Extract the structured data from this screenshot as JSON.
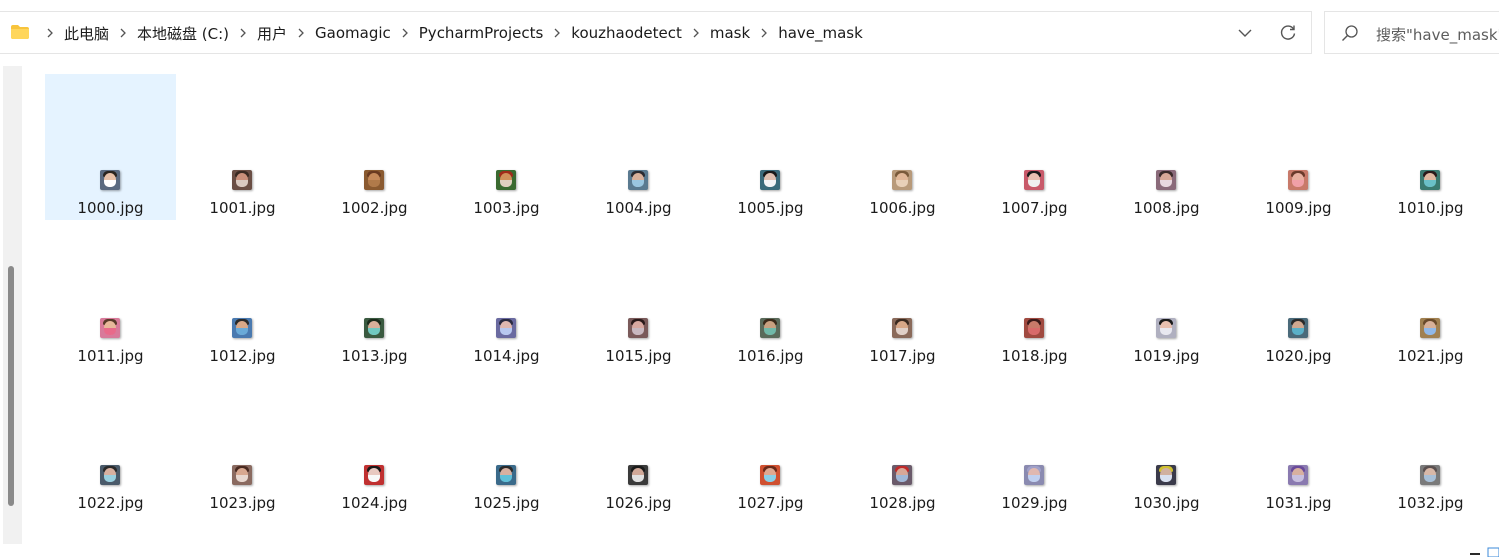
{
  "address_bar": {
    "crumbs": [
      "此电脑",
      "本地磁盘 (C:)",
      "用户",
      "Gaomagic",
      "PycharmProjects",
      "kouzhaodetect",
      "mask",
      "have_mask"
    ]
  },
  "search": {
    "placeholder": "搜索\"have_mask\""
  },
  "colors": {
    "selected_bg": "#e5f3ff",
    "folder_yellow": "#f8c43c",
    "text": "#1b1b1b"
  },
  "files": [
    {
      "name": "1000.jpg",
      "selected": true,
      "face": "#e8c1a8",
      "mask": "#ffffff",
      "bg": "#5a6a80",
      "hair": "#2a2520"
    },
    {
      "name": "1001.jpg",
      "face": "#c98f7a",
      "mask": "#d9c9c0",
      "bg": "#6a4e44",
      "hair": "#3a2a22"
    },
    {
      "name": "1002.jpg",
      "face": "#c68a5a",
      "mask": "#b07a4a",
      "bg": "#8a5a30",
      "hair": "#6a3a20"
    },
    {
      "name": "1003.jpg",
      "face": "#d0905a",
      "mask": "#e0d0c0",
      "bg": "#3a6a30",
      "hair": "#a02a1a"
    },
    {
      "name": "1004.jpg",
      "face": "#d8b09a",
      "mask": "#9ac6e0",
      "bg": "#5a7a90",
      "hair": "#2a2a30"
    },
    {
      "name": "1005.jpg",
      "face": "#e0c0b0",
      "mask": "#f4f4f6",
      "bg": "#3a6a7a",
      "hair": "#1a1a1a"
    },
    {
      "name": "1006.jpg",
      "face": "#e2b898",
      "mask": "#e8d0b8",
      "bg": "#b89a7a",
      "hair": "#7a5a3a"
    },
    {
      "name": "1007.jpg",
      "face": "#e8c0b0",
      "mask": "#f0f0f0",
      "bg": "#c85a6a",
      "hair": "#1a1a1a"
    },
    {
      "name": "1008.jpg",
      "face": "#d8a898",
      "mask": "#e8d8e0",
      "bg": "#8a6a7a",
      "hair": "#3a2a2a"
    },
    {
      "name": "1009.jpg",
      "face": "#e8b0a0",
      "mask": "#f0a0a8",
      "bg": "#c87a6a",
      "hair": "#6a3a2a"
    },
    {
      "name": "1010.jpg",
      "face": "#e0b8a0",
      "mask": "#6ac0c8",
      "bg": "#3a7a70",
      "hair": "#2a1a1a"
    },
    {
      "name": "1011.jpg",
      "face": "#e8b89a",
      "mask": "#e86a8a",
      "bg": "#d87a9a",
      "hair": "#5a3a2a"
    },
    {
      "name": "1012.jpg",
      "face": "#d8a888",
      "mask": "#6aaad8",
      "bg": "#4a7ab0",
      "hair": "#2a2a2a"
    },
    {
      "name": "1013.jpg",
      "face": "#d8b09a",
      "mask": "#70c8c0",
      "bg": "#3a5a40",
      "hair": "#1a2a1a"
    },
    {
      "name": "1014.jpg",
      "face": "#e0b8b0",
      "mask": "#b8c8f0",
      "bg": "#6a6aa0",
      "hair": "#2a2a40"
    },
    {
      "name": "1015.jpg",
      "face": "#d8a8a0",
      "mask": "#c8b8c0",
      "bg": "#7a5a5a",
      "hair": "#2a1a1a"
    },
    {
      "name": "1016.jpg",
      "face": "#c8a080",
      "mask": "#70b8a8",
      "bg": "#5a6a5a",
      "hair": "#3a2a1a"
    },
    {
      "name": "1017.jpg",
      "face": "#d8a888",
      "mask": "#e0d0c8",
      "bg": "#8a6a5a",
      "hair": "#3a2a20"
    },
    {
      "name": "1018.jpg",
      "face": "#c87a6a",
      "mask": "#d86a6a",
      "bg": "#a04a40",
      "hair": "#3a1a1a"
    },
    {
      "name": "1019.jpg",
      "face": "#e8c0b0",
      "mask": "#e8e8f0",
      "bg": "#b0b0c0",
      "hair": "#1a1a1a"
    },
    {
      "name": "1020.jpg",
      "face": "#d0a890",
      "mask": "#5ab0c8",
      "bg": "#4a6a7a",
      "hair": "#2a2a2a"
    },
    {
      "name": "1021.jpg",
      "face": "#d8b098",
      "mask": "#90b8e8",
      "bg": "#a08050",
      "hair": "#6a4a2a"
    },
    {
      "name": "1022.jpg",
      "face": "#d8b0a0",
      "mask": "#9ad0e0",
      "bg": "#4a5a6a",
      "hair": "#2a2a2a"
    },
    {
      "name": "1023.jpg",
      "face": "#d8a890",
      "mask": "#e8d8d0",
      "bg": "#8a6a60",
      "hair": "#4a2a20"
    },
    {
      "name": "1024.jpg",
      "face": "#e8c8c0",
      "mask": "#f8f8f8",
      "bg": "#c03030",
      "hair": "#1a1a1a"
    },
    {
      "name": "1025.jpg",
      "face": "#d8b0a0",
      "mask": "#60c0d8",
      "bg": "#3a6a8a",
      "hair": "#2a2a2a"
    },
    {
      "name": "1026.jpg",
      "face": "#d0a898",
      "mask": "#e0e0e0",
      "bg": "#3a3a3a",
      "hair": "#1a1a1a"
    },
    {
      "name": "1027.jpg",
      "face": "#e0a890",
      "mask": "#8ad0e8",
      "bg": "#d05030",
      "hair": "#6a2a1a"
    },
    {
      "name": "1028.jpg",
      "face": "#d8a898",
      "mask": "#a0b8d8",
      "bg": "#6a5a6a",
      "hair": "#c02a2a"
    },
    {
      "name": "1029.jpg",
      "face": "#e0b8b0",
      "mask": "#c0d0f0",
      "bg": "#8a8ab0",
      "hair": "#a0a0c8"
    },
    {
      "name": "1030.jpg",
      "face": "#d0b0a0",
      "mask": "#d8e0f0",
      "bg": "#3a3a4a",
      "hair": "#d0c030"
    },
    {
      "name": "1031.jpg",
      "face": "#d8b0a0",
      "mask": "#c8c0e0",
      "bg": "#8a7ab0",
      "hair": "#6a4a9a"
    },
    {
      "name": "1032.jpg",
      "face": "#d8b8a8",
      "mask": "#a8c0d8",
      "bg": "#7a7a7a",
      "hair": "#5a5050"
    }
  ]
}
